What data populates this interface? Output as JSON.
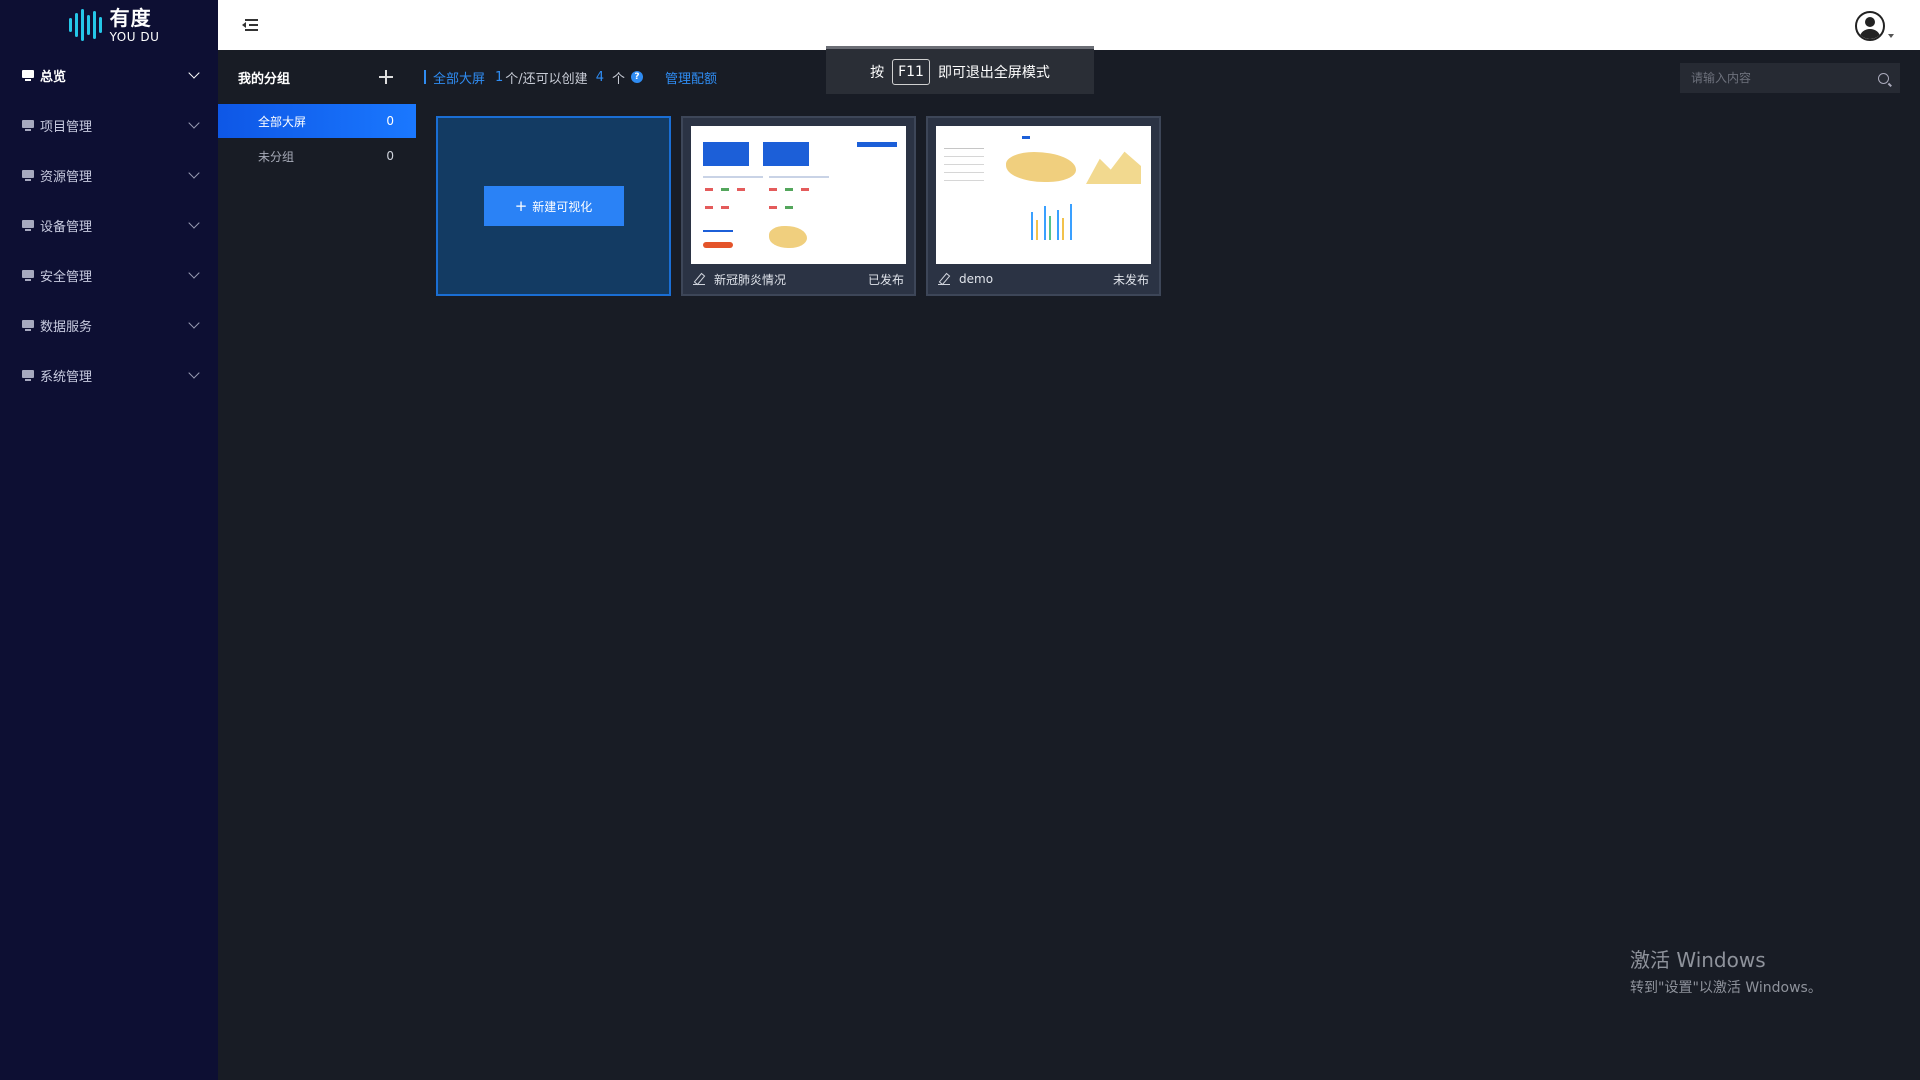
{
  "logo": {
    "cn": "有度",
    "en": "YOU DU"
  },
  "sidebar": {
    "items": [
      {
        "label": "总览",
        "active": true
      },
      {
        "label": "项目管理",
        "active": false
      },
      {
        "label": "资源管理",
        "active": false
      },
      {
        "label": "设备管理",
        "active": false
      },
      {
        "label": "安全管理",
        "active": false
      },
      {
        "label": "数据服务",
        "active": false
      },
      {
        "label": "系统管理",
        "active": false
      }
    ]
  },
  "groups": {
    "title": "我的分组",
    "items": [
      {
        "label": "全部大屏",
        "count": "0",
        "active": true
      },
      {
        "label": "未分组",
        "count": "0",
        "active": false
      }
    ]
  },
  "info": {
    "current": "全部大屏",
    "created": "1",
    "mid_text": "个/还可以创建",
    "remaining": "4",
    "unit": "个",
    "manage_label": "管理配额"
  },
  "fullscreen_hint": {
    "prefix": "按",
    "key": "F11",
    "suffix": "即可退出全屏模式"
  },
  "search": {
    "placeholder": "请输入内容"
  },
  "new_card": {
    "label": "新建可视化"
  },
  "screens": [
    {
      "title": "新冠肺炎情况",
      "status": "已发布"
    },
    {
      "title": "demo",
      "status": "未发布"
    }
  ],
  "watermark": {
    "title": "激活 Windows",
    "subtitle": "转到\"设置\"以激活 Windows。"
  },
  "colors": {
    "sidebar_bg": "#0d0f33",
    "accent": "#1a78ff",
    "link": "#2f8cf2",
    "page_bg": "#181c25"
  },
  "icons": {
    "menu": "menu-fold-icon",
    "search": "search-icon",
    "avatar": "user-avatar-icon",
    "add": "plus-icon",
    "edit": "edit-icon"
  }
}
